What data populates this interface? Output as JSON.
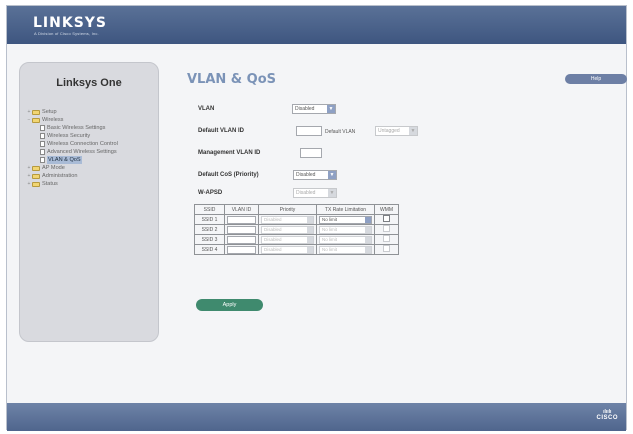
{
  "header": {
    "brand": "LINKSYS",
    "tagline": "A Division of Cisco Systems, Inc."
  },
  "sidebar": {
    "title": "Linksys One",
    "items": [
      {
        "label": "Setup",
        "type": "folder",
        "expander": "+"
      },
      {
        "label": "Wireless",
        "type": "folder",
        "expander": "−"
      },
      {
        "label": "Basic Wireless Settings",
        "type": "page"
      },
      {
        "label": "Wireless Security",
        "type": "page"
      },
      {
        "label": "Wireless Connection Control",
        "type": "page"
      },
      {
        "label": "Advanced Wireless Settings",
        "type": "page"
      },
      {
        "label": "VLAN & QoS",
        "type": "page",
        "active": true
      },
      {
        "label": "AP Mode",
        "type": "folder",
        "expander": "+"
      },
      {
        "label": "Administration",
        "type": "folder",
        "expander": "+"
      },
      {
        "label": "Status",
        "type": "folder",
        "expander": "+"
      }
    ]
  },
  "main": {
    "title": "VLAN & QoS",
    "help_label": "Help",
    "fields": {
      "vlan_label": "VLAN",
      "vlan_value": "Disabled",
      "default_vlan_id_label": "Default VLAN ID",
      "default_vlan_label": "Default VLAN",
      "default_vlan_value": "Untagged",
      "mgmt_vlan_id_label": "Management VLAN ID",
      "default_cos_label": "Default CoS (Priority)",
      "default_cos_value": "Disabled",
      "wapsd_label": "W-APSD",
      "wapsd_value": "Disabled"
    },
    "table": {
      "headers": [
        "SSID",
        "VLAN ID",
        "Priority",
        "TX Rate Limitation",
        "WMM"
      ],
      "rows": [
        {
          "ssid": "SSID 1",
          "priority": "Disabled",
          "tx": "No limit"
        },
        {
          "ssid": "SSID 2",
          "priority": "Disabled",
          "tx": "No limit"
        },
        {
          "ssid": "SSID 3",
          "priority": "Disabled",
          "tx": "No limit"
        },
        {
          "ssid": "SSID 4",
          "priority": "Disabled",
          "tx": "No limit"
        }
      ]
    },
    "apply_label": "Apply"
  },
  "footer": {
    "logo_text": "CISCO",
    "logo_bars": "ılıılı"
  },
  "colors": {
    "header": "#3e5680",
    "title": "#7b93b7",
    "apply": "#3f8a6e",
    "help": "#6d7fa5"
  }
}
